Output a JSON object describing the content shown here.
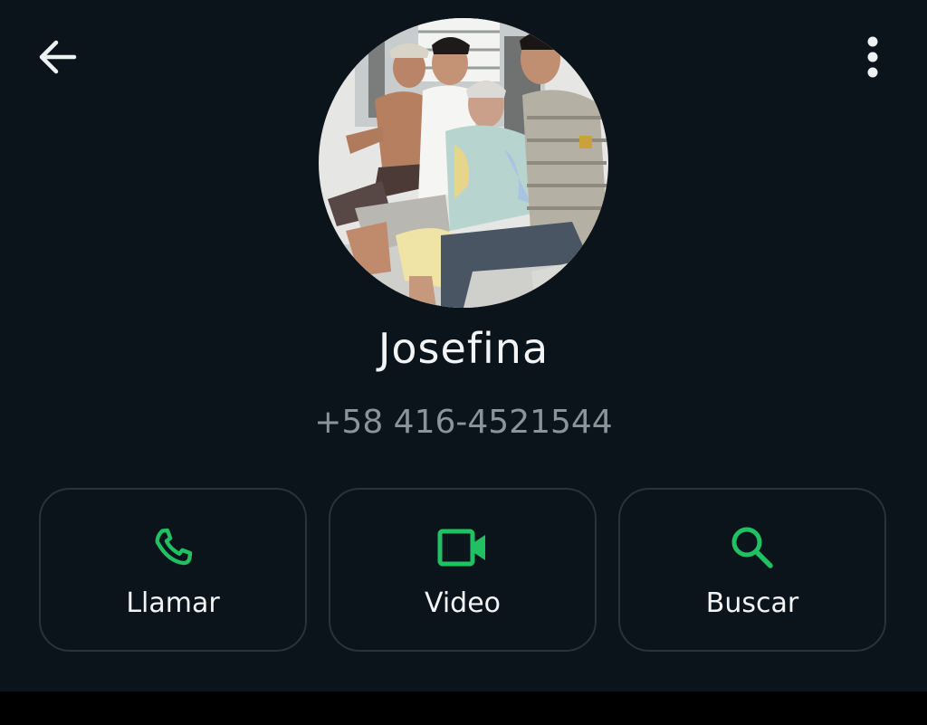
{
  "header": {
    "back_icon": "arrow-left-icon",
    "more_icon": "more-vertical-icon"
  },
  "contact": {
    "name": "Josefina",
    "phone": "+58 416-4521544",
    "avatar": "profile-photo"
  },
  "actions": [
    {
      "label": "Llamar",
      "icon": "phone-icon"
    },
    {
      "label": "Video",
      "icon": "video-camera-icon"
    },
    {
      "label": "Buscar",
      "icon": "search-icon"
    }
  ],
  "colors": {
    "background": "#0b141b",
    "accent": "#21c063",
    "text_primary": "#f2f4f5",
    "text_secondary": "#8a9499",
    "card_border": "#2a3338"
  }
}
